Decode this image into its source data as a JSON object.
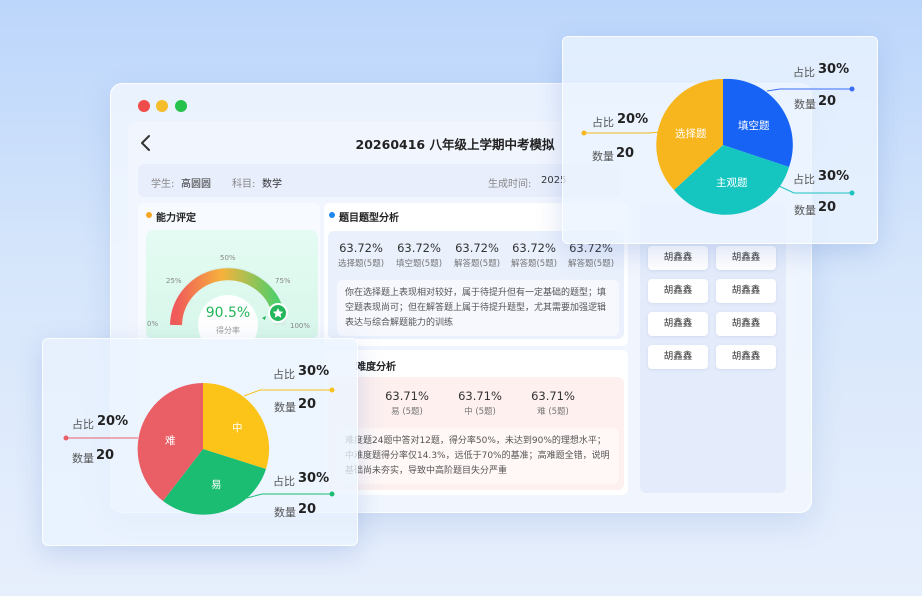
{
  "page": {
    "title": "20260416 八年级上学期中考模拟",
    "student_label": "学生:",
    "student_name": "高圆圆",
    "subject_label": "科目:",
    "subject": "数学",
    "generated_label": "生成时间:",
    "generated_value": "2025"
  },
  "ability": {
    "title": "能力评定",
    "gauge_ticks": [
      "0%",
      "25%",
      "50%",
      "75%",
      "100%"
    ],
    "score": "90.5%",
    "score_label": "得分率",
    "score_fraction": 0.905
  },
  "question_types": {
    "title": "题目题型分析",
    "stats": [
      {
        "value": "63.72%",
        "label": "选择题(5题)"
      },
      {
        "value": "63.72%",
        "label": "填空题(5题)"
      },
      {
        "value": "63.72%",
        "label": "解答题(5题)"
      },
      {
        "value": "63.72%",
        "label": "解答题(5题)"
      },
      {
        "value": "63.72%",
        "label": "解答题(5题)"
      }
    ],
    "note": "你在选择题上表现相对较好，属于待提升但有一定基础的题型；填空题表现尚可；但在解答题上属于待提升题型，尤其需要加强逻辑表达与综合解题能力的训练"
  },
  "difficulty": {
    "title": "难度分析",
    "stats": [
      {
        "value": "63.71%",
        "label": "易  (5题)"
      },
      {
        "value": "63.71%",
        "label": "中  (5题)"
      },
      {
        "value": "63.71%",
        "label": "难  (5题)"
      }
    ],
    "note": "难度题24题中答对12题，得分率50%，未达到90%的理想水平；中难度题得分率仅14.3%，远低于70%的基准；高难题全错，说明基础尚未夯实，导致中高阶题目失分严重"
  },
  "names": [
    "胡鑫鑫",
    "胡鑫鑫",
    "胡鑫鑫",
    "胡鑫鑫",
    "胡鑫鑫",
    "胡鑫鑫",
    "胡鑫鑫",
    "胡鑫鑫"
  ],
  "popup_type": {
    "legend": [
      {
        "ratio_label": "占比",
        "ratio": "30%",
        "count_label": "数量",
        "count": "20"
      },
      {
        "ratio_label": "占比",
        "ratio": "20%",
        "count_label": "数量",
        "count": "20"
      },
      {
        "ratio_label": "占比",
        "ratio": "30%",
        "count_label": "数量",
        "count": "20"
      }
    ],
    "slices": [
      "填空题",
      "选择题",
      "主观题"
    ]
  },
  "popup_difficulty": {
    "legend": [
      {
        "ratio_label": "占比",
        "ratio": "30%",
        "count_label": "数量",
        "count": "20"
      },
      {
        "ratio_label": "占比",
        "ratio": "20%",
        "count_label": "数量",
        "count": "20"
      },
      {
        "ratio_label": "占比",
        "ratio": "30%",
        "count_label": "数量",
        "count": "20"
      }
    ],
    "slices": [
      "中",
      "难",
      "易"
    ]
  },
  "colors": {
    "blue": "#1763f5",
    "yellow": "#f7b61e",
    "teal": "#15c6c0",
    "red": "#ea5e66",
    "green": "#1bbd72",
    "orange_bullet": "#f5a623"
  }
}
